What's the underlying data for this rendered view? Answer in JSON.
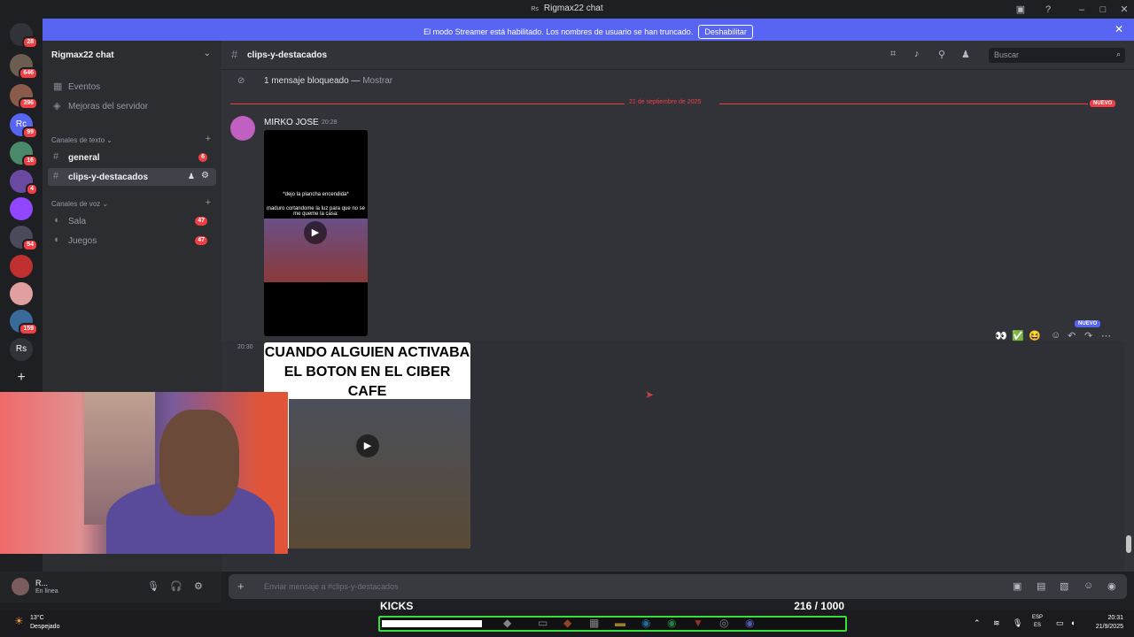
{
  "window": {
    "title": "Rigmax22 chat",
    "title_prefix": "Rs"
  },
  "banner": {
    "message": "El modo Streamer está habilitado. Los nombres de usuario se han truncado.",
    "disable_label": "Deshabilitar"
  },
  "servers": [
    {
      "name": "discord-home",
      "badge": "28",
      "color": "#313338"
    },
    {
      "name": "server-1",
      "badge": "646",
      "color": "#6b5d4f"
    },
    {
      "name": "server-2",
      "badge": "396",
      "color": "#8a5a4a"
    },
    {
      "name": "server-rc",
      "badge": "99",
      "color": "#5865f2",
      "letters": "Rc"
    },
    {
      "name": "server-3",
      "badge": "16",
      "color": "#4a8a6a"
    },
    {
      "name": "server-4",
      "badge": "4",
      "color": "#6a4aa0"
    },
    {
      "name": "server-twitch",
      "badge": "",
      "color": "#9146ff"
    },
    {
      "name": "server-5",
      "badge": "54",
      "color": "#4a4a5a"
    },
    {
      "name": "server-6",
      "badge": "",
      "color": "#c03030"
    },
    {
      "name": "server-7",
      "badge": "",
      "color": "#e0a0a0"
    },
    {
      "name": "server-8",
      "badge": "159",
      "color": "#3a6a9a"
    },
    {
      "name": "server-rs",
      "badge": "",
      "color": "#313338",
      "letters": "Rs"
    }
  ],
  "sidebar": {
    "server_name": "Rigmax22 chat",
    "events_label": "Eventos",
    "boost_label": "Mejoras del servidor",
    "text_category": "Canales de texto",
    "text_channels": [
      {
        "name": "general",
        "count": "6"
      },
      {
        "name": "clips-y-destacados",
        "count": ""
      }
    ],
    "voice_category": "Canales de voz",
    "voice_channels": [
      {
        "name": "Sala",
        "count": "47"
      },
      {
        "name": "Juegos",
        "count": "47"
      }
    ]
  },
  "user": {
    "name": "R...",
    "status": "En línea"
  },
  "header": {
    "channel": "clips-y-destacados",
    "search_placeholder": "Buscar"
  },
  "chat": {
    "blocked_text": "1 mensaje bloqueado — ",
    "blocked_show": "Mostrar",
    "date_divider": "21 de septiembre de 2025",
    "new_label": "NUEVO",
    "msg1": {
      "author": "MIRKO JOSE",
      "time": "20:28",
      "caption1": "*dejo la plancha encendida*",
      "caption2": "maduro cortandome la luz para que no se me queme la casa:"
    },
    "msg2": {
      "time": "20:30",
      "headline": "CUANDO ALGUIEN ACTIVABA EL BOTON EN EL CIBER CAFE"
    },
    "reactions": [
      "👀",
      "✅",
      "😆"
    ]
  },
  "composer": {
    "placeholder": "Enviar mensaje a #clips-y-destacados"
  },
  "kicks": {
    "label": "KICKS",
    "current": "216",
    "separator": " / ",
    "goal": "1000",
    "progress_fraction": 0.216
  },
  "taskbar": {
    "temp": "13°C",
    "condition": "Despejado",
    "lang_top": "ESP",
    "lang_bottom": "ES",
    "time": "20:31",
    "date": "21/9/2025"
  }
}
